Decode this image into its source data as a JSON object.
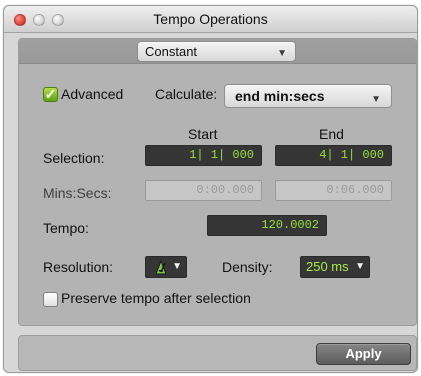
{
  "window": {
    "title": "Tempo Operations"
  },
  "operation_popup": {
    "value": "Constant"
  },
  "advanced": {
    "label": "Advanced",
    "checked": true,
    "checkmark": "✓"
  },
  "calculate": {
    "label": "Calculate:",
    "value": "end min:secs"
  },
  "columns": {
    "start": "Start",
    "end": "End"
  },
  "selection": {
    "label": "Selection:",
    "start": "1| 1| 000",
    "end": "4| 1| 000"
  },
  "mins_secs": {
    "label": "Mins:Secs:",
    "start": "0:00.000",
    "end": "0:06.000"
  },
  "tempo": {
    "label": "Tempo:",
    "value": "120.0002"
  },
  "resolution": {
    "label": "Resolution:",
    "icon": "metronome-icon"
  },
  "density": {
    "label": "Density:",
    "value": "250 ms"
  },
  "preserve_tempo": {
    "label": "Preserve tempo after selection",
    "checked": false
  },
  "apply": {
    "label": "Apply"
  },
  "colors": {
    "accent_green": "#99df38",
    "dark_field": "#353535",
    "panel_gray": "#b3b3b3",
    "close_red": "#e14a3f"
  }
}
